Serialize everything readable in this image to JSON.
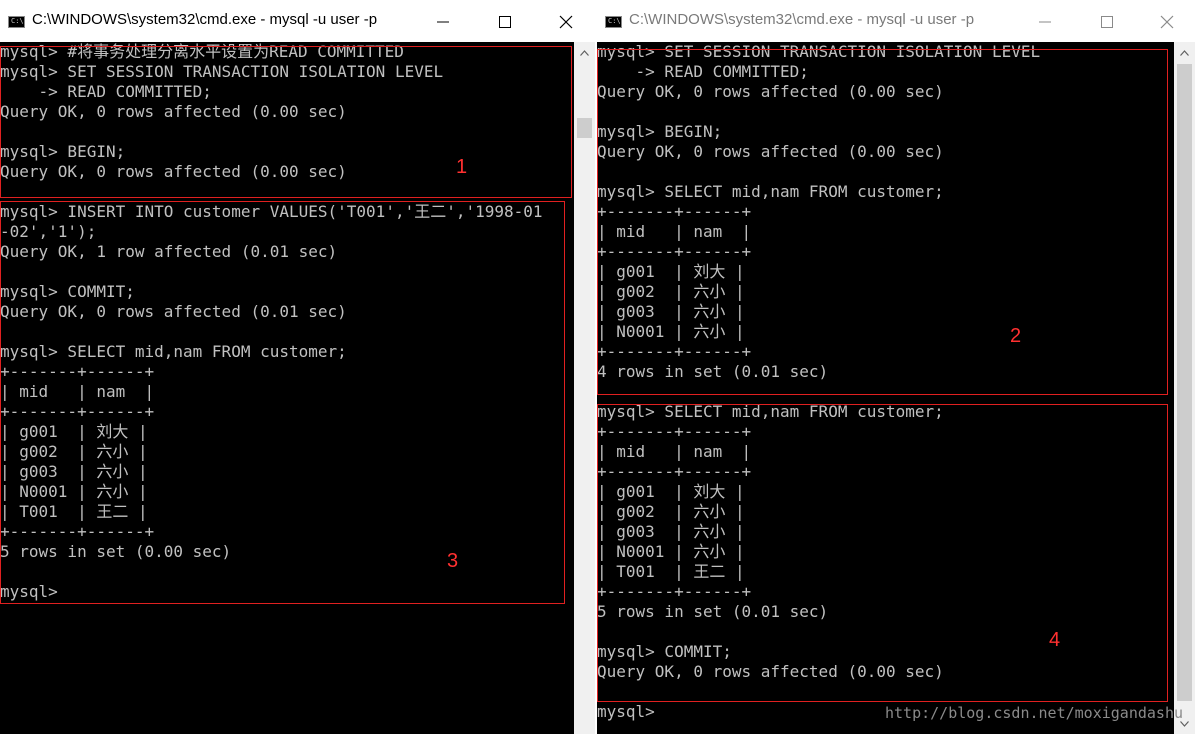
{
  "left_window": {
    "title": "C:\\WINDOWS\\system32\\cmd.exe - mysql  -u user -p",
    "icon_text": "C:\\",
    "lines": [
      "mysql> #将事务处理分离水平设置为READ COMMITTED",
      "mysql> SET SESSION TRANSACTION ISOLATION LEVEL",
      "    -> READ COMMITTED;",
      "Query OK, 0 rows affected (0.00 sec)",
      "",
      "mysql> BEGIN;",
      "Query OK, 0 rows affected (0.00 sec)",
      "",
      "mysql> INSERT INTO customer VALUES('T001','王二','1998-01",
      "-02','1');",
      "Query OK, 1 row affected (0.01 sec)",
      "",
      "mysql> COMMIT;",
      "Query OK, 0 rows affected (0.01 sec)",
      "",
      "mysql> SELECT mid,nam FROM customer;",
      "+-------+------+",
      "| mid   | nam  |",
      "+-------+------+",
      "| g001  | 刘大 |",
      "| g002  | 六小 |",
      "| g003  | 六小 |",
      "| N0001 | 六小 |",
      "| T001  | 王二 |",
      "+-------+------+",
      "5 rows in set (0.00 sec)",
      "",
      "mysql>"
    ],
    "annotations": [
      "1",
      "3"
    ]
  },
  "right_window": {
    "title": "C:\\WINDOWS\\system32\\cmd.exe - mysql  -u user -p",
    "icon_text": "C:\\",
    "lines": [
      "mysql> SET SESSION TRANSACTION ISOLATION LEVEL",
      "    -> READ COMMITTED;",
      "Query OK, 0 rows affected (0.00 sec)",
      "",
      "mysql> BEGIN;",
      "Query OK, 0 rows affected (0.00 sec)",
      "",
      "mysql> SELECT mid,nam FROM customer;",
      "+-------+------+",
      "| mid   | nam  |",
      "+-------+------+",
      "| g001  | 刘大 |",
      "| g002  | 六小 |",
      "| g003  | 六小 |",
      "| N0001 | 六小 |",
      "+-------+------+",
      "4 rows in set (0.01 sec)",
      "mysql> SELECT mid,nam FROM customer;",
      "+-------+------+",
      "| mid   | nam  |",
      "+-------+------+",
      "| g001  | 刘大 |",
      "| g002  | 六小 |",
      "| g003  | 六小 |",
      "| N0001 | 六小 |",
      "| T001  | 王二 |",
      "+-------+------+",
      "5 rows in set (0.01 sec)",
      "",
      "mysql> COMMIT;",
      "Query OK, 0 rows affected (0.00 sec)",
      "mysql>"
    ],
    "annotations": [
      "2",
      "4"
    ]
  },
  "watermark": "http://blog.csdn.net/moxigandashu",
  "colors": {
    "terminal_bg": "#000000",
    "terminal_text": "#c0c0c0",
    "annotation_red": "#e02020",
    "titlebar_bg": "#ffffff"
  },
  "icons": [
    "cmd-app-icon",
    "minimize-icon",
    "maximize-icon",
    "close-icon",
    "scroll-up-icon",
    "scroll-down-icon"
  ]
}
